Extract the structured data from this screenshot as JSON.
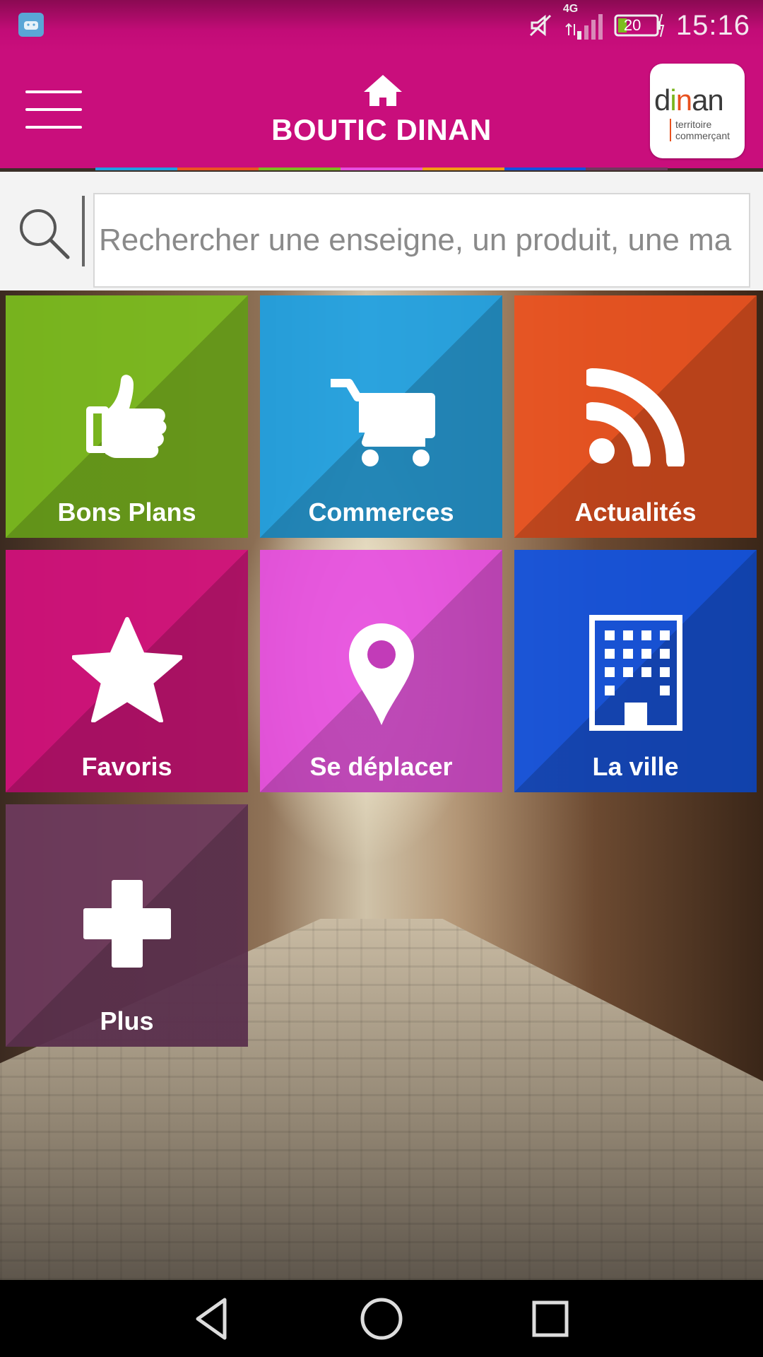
{
  "status_bar": {
    "network": "4G",
    "battery": "20",
    "time": "15:16"
  },
  "app_bar": {
    "title": "BOUTIC DINAN",
    "logo": {
      "word_part1": "d",
      "word_part2": "i",
      "word_part3": "n",
      "word_part4": "a",
      "word_part5": "n",
      "subline1": "territoire",
      "subline2": "commerçant"
    }
  },
  "search": {
    "placeholder": "Rechercher une enseigne, un produit, une ma"
  },
  "tiles": [
    {
      "label": "Bons Plans",
      "icon": "thumbs-up-icon",
      "color": "#7cbd1e"
    },
    {
      "label": "Commerces",
      "icon": "cart-icon",
      "color": "#1ea0e2"
    },
    {
      "label": "Actualités",
      "icon": "rss-icon",
      "color": "#ec5320"
    },
    {
      "label": "Favoris",
      "icon": "star-icon",
      "color": "#d4107d"
    },
    {
      "label": "Se déplacer",
      "icon": "map-pin-icon",
      "color": "#e64fe0"
    },
    {
      "label": "La ville",
      "icon": "building-icon",
      "color": "#1253e0"
    },
    {
      "label": "Plus",
      "icon": "plus-icon",
      "color": "#6e3a5e"
    }
  ],
  "colors": {
    "app_bar": "#c90e7c",
    "accent_line": [
      "#1ea0e2",
      "#ec5320",
      "#7cbd1e",
      "#e64fe0",
      "#f39c12",
      "#1253e0",
      "#6e3a5e"
    ]
  }
}
